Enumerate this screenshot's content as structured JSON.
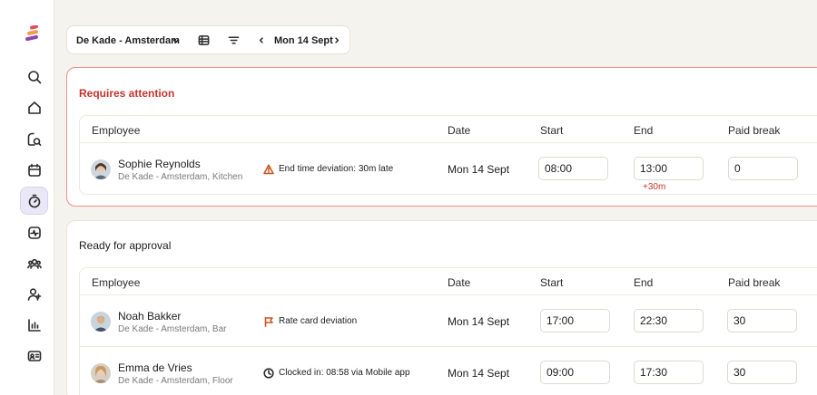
{
  "sidebar": {
    "items": [
      {
        "icon": "search-icon"
      },
      {
        "icon": "home-icon"
      },
      {
        "icon": "search-calendar-icon"
      },
      {
        "icon": "calendar-icon"
      },
      {
        "icon": "stopwatch-icon",
        "active": true
      },
      {
        "icon": "activity-icon"
      },
      {
        "icon": "team-icon"
      },
      {
        "icon": "add-user-icon"
      },
      {
        "icon": "bar-chart-icon"
      },
      {
        "icon": "id-card-icon"
      }
    ]
  },
  "toolbar": {
    "location": "De Kade - Amsterdam",
    "date": "Mon 14 Sept"
  },
  "attention": {
    "title": "Requires attention",
    "headers": {
      "employee": "Employee",
      "date": "Date",
      "start": "Start",
      "end": "End",
      "paid_break": "Paid break"
    },
    "rows": [
      {
        "name": "Sophie Reynolds",
        "sub": "De Kade - Amsterdam, Kitchen",
        "note_icon": "warning-icon",
        "note": "End time deviation: 30m late",
        "date": "Mon 14 Sept",
        "start": "08:00",
        "end": "13:00",
        "paid_break": "0",
        "deviation": "+30m"
      }
    ]
  },
  "ready": {
    "title": "Ready for approval",
    "headers": {
      "employee": "Employee",
      "date": "Date",
      "start": "Start",
      "end": "End",
      "paid_break": "Paid break"
    },
    "rows": [
      {
        "name": "Noah Bakker",
        "sub": "De Kade - Amsterdam, Bar",
        "note_icon": "flag-icon",
        "note": "Rate card deviation",
        "date": "Mon 14 Sept",
        "start": "17:00",
        "end": "22:30",
        "paid_break": "30"
      },
      {
        "name": "Emma de Vries",
        "sub": "De Kade - Amsterdam, Floor",
        "note_icon": "clock-icon",
        "note": "Clocked in: 08:58 via Mobile app",
        "date": "Mon 14 Sept",
        "start": "09:00",
        "end": "17:30",
        "paid_break": "30"
      }
    ]
  },
  "colors": {
    "accent_red": "#c4352d",
    "active_nav": "#eae8f6",
    "warning_orange": "#c8571f"
  }
}
